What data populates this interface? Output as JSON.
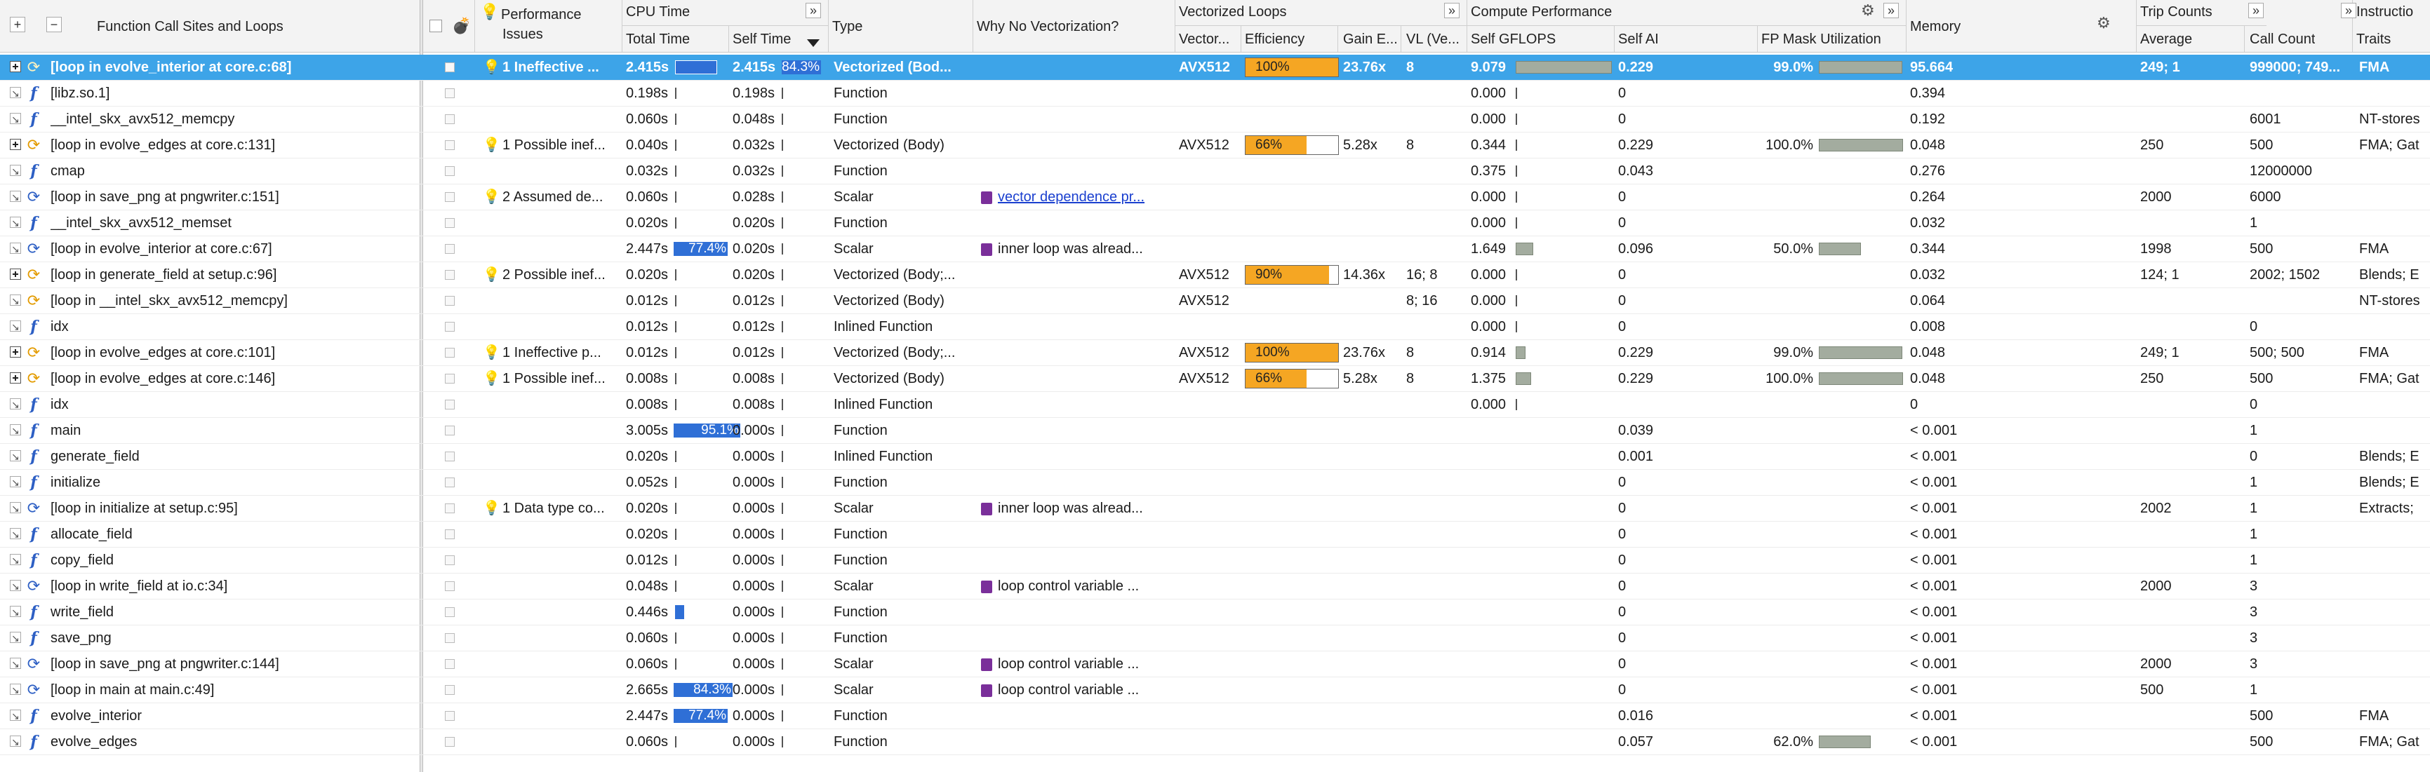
{
  "header": {
    "expand_all": "+",
    "collapse_all": "−",
    "function_col": "Function Call Sites and Loops",
    "perf_issues": [
      "Performance",
      "Issues"
    ],
    "cpu_time": "CPU Time",
    "total_time": "Total Time",
    "self_time": "Self Time",
    "type": "Type",
    "why_no_vec": "Why No Vectorization?",
    "vectorized_loops": "Vectorized Loops",
    "vector_isa": "Vector...",
    "efficiency": "Efficiency",
    "gain": "Gain E...",
    "vl": "VL (Ve...",
    "compute_perf": "Compute Performance",
    "self_gflops": "Self GFLOPS",
    "self_ai": "Self AI",
    "fp_mask": "FP Mask Utilization",
    "memory": "Memory",
    "trip_counts": "Trip Counts",
    "average": "Average",
    "call_count": "Call Count",
    "instructions": "Instructio",
    "traits": "Traits"
  },
  "rows": [
    {
      "kind": "loop-vec",
      "expand": "plus",
      "name": "[loop in evolve_interior at core.c:68]",
      "issue": "1 Ineffective ...",
      "bulb": "on",
      "total": "2.415s",
      "total_bar": 0,
      "self": "2.415s",
      "self_bar": 0.843,
      "self_label": "84.3%",
      "type": "Vectorized (Bod...",
      "why": "",
      "isa": "AVX512",
      "eff": 1.0,
      "eff_label": "100%",
      "gain": "23.76x",
      "vl": "8",
      "gflops": "9.079",
      "gflops_bar": 0.7,
      "ai": "0.229",
      "fpmask": "99.0%",
      "fpmask_bar": 0.99,
      "mem": "95.664",
      "avg": "249; 1",
      "calls": "999000; 749...",
      "traits": "FMA",
      "selected": true
    },
    {
      "kind": "fn",
      "expand": "arrow",
      "name": "[libz.so.1]",
      "issue": "",
      "total": "0.198s",
      "total_thin": true,
      "self": "0.198s",
      "self_thin": true,
      "type": "Function",
      "why": "",
      "isa": "",
      "eff_label": "",
      "gain": "",
      "vl": "",
      "gflops": "0.000",
      "gflops_thin": true,
      "ai": "0",
      "fpmask": "",
      "mem": "0.394",
      "avg": "",
      "calls": "",
      "traits": ""
    },
    {
      "kind": "fn",
      "expand": "arrow",
      "name": "__intel_skx_avx512_memcpy",
      "issue": "",
      "total": "0.060s",
      "total_thin": true,
      "self": "0.048s",
      "self_thin": true,
      "type": "Function",
      "why": "",
      "isa": "",
      "eff_label": "",
      "gain": "",
      "vl": "",
      "gflops": "0.000",
      "gflops_thin": true,
      "ai": "0",
      "fpmask": "",
      "mem": "0.192",
      "avg": "",
      "calls": "6001",
      "traits": "NT-stores"
    },
    {
      "kind": "loop-vec",
      "expand": "plus",
      "name": "[loop in evolve_edges at core.c:131]",
      "issue": "1 Possible inef...",
      "bulb": "on",
      "total": "0.040s",
      "total_thin": true,
      "self": "0.032s",
      "self_thin": true,
      "type": "Vectorized (Body)",
      "why": "",
      "isa": "AVX512",
      "eff": 0.66,
      "eff_label": "66%",
      "gain": "5.28x",
      "vl": "8",
      "gflops": "0.344",
      "gflops_thin": true,
      "ai": "0.229",
      "fpmask": "100.0%",
      "fpmask_bar": 1.0,
      "mem": "0.048",
      "avg": "250",
      "calls": "500",
      "traits": "FMA; Gat"
    },
    {
      "kind": "fn",
      "expand": "arrow",
      "name": "cmap",
      "issue": "",
      "total": "0.032s",
      "total_thin": true,
      "self": "0.032s",
      "self_thin": true,
      "type": "Function",
      "why": "",
      "isa": "",
      "eff_label": "",
      "gain": "",
      "vl": "",
      "gflops": "0.375",
      "gflops_thin": true,
      "ai": "0.043",
      "fpmask": "",
      "mem": "0.276",
      "avg": "",
      "calls": "12000000",
      "traits": ""
    },
    {
      "kind": "loop",
      "expand": "arrow",
      "name": "[loop in save_png at pngwriter.c:151]",
      "issue": "2 Assumed de...",
      "bulb": "on",
      "total": "0.060s",
      "total_thin": true,
      "self": "0.028s",
      "self_thin": true,
      "type": "Scalar",
      "why": "vector dependence pr...",
      "why_link": true,
      "isa": "",
      "eff_label": "",
      "gain": "",
      "vl": "",
      "gflops": "0.000",
      "gflops_thin": true,
      "ai": "0",
      "fpmask": "",
      "mem": "0.264",
      "avg": "2000",
      "calls": "6000",
      "traits": ""
    },
    {
      "kind": "fn",
      "expand": "arrow",
      "name": "__intel_skx_avx512_memset",
      "issue": "",
      "total": "0.020s",
      "total_thin": true,
      "self": "0.020s",
      "self_thin": true,
      "type": "Function",
      "why": "",
      "isa": "",
      "eff_label": "",
      "gain": "",
      "vl": "",
      "gflops": "0.000",
      "gflops_thin": true,
      "ai": "0",
      "fpmask": "",
      "mem": "0.032",
      "avg": "",
      "calls": "1",
      "traits": ""
    },
    {
      "kind": "loop",
      "expand": "arrow",
      "name": "[loop in evolve_interior at core.c:67]",
      "issue": "",
      "total": "2.447s",
      "total_bar": 0.774,
      "total_label": "77.4%",
      "self": "0.020s",
      "self_thin": true,
      "type": "Scalar",
      "why": "inner loop was alread...",
      "isa": "",
      "eff_label": "",
      "gain": "",
      "vl": "",
      "gflops": "1.649",
      "gflops_small": 0.13,
      "ai": "0.096",
      "fpmask": "50.0%",
      "fpmask_bar": 0.5,
      "mem": "0.344",
      "avg": "1998",
      "calls": "500",
      "traits": "FMA"
    },
    {
      "kind": "loop-vec",
      "expand": "plus",
      "name": "[loop in generate_field at setup.c:96]",
      "issue": "2 Possible inef...",
      "bulb": "on",
      "total": "0.020s",
      "total_thin": true,
      "self": "0.020s",
      "self_thin": true,
      "type": "Vectorized (Body;...",
      "why": "",
      "isa": "AVX512",
      "eff": 0.9,
      "eff_label": "90%",
      "gain": "14.36x",
      "vl": "16; 8",
      "gflops": "0.000",
      "gflops_thin": true,
      "ai": "0",
      "fpmask": "",
      "mem": "0.032",
      "avg": "124; 1",
      "calls": "2002; 1502",
      "traits": "Blends; E"
    },
    {
      "kind": "loop-vec",
      "expand": "arrow",
      "name": "[loop in __intel_skx_avx512_memcpy]",
      "issue": "",
      "total": "0.012s",
      "total_thin": true,
      "self": "0.012s",
      "self_thin": true,
      "type": "Vectorized (Body)",
      "why": "",
      "isa": "AVX512",
      "eff_label": "",
      "gain": "",
      "vl": "8; 16",
      "gflops": "0.000",
      "gflops_thin": true,
      "ai": "0",
      "fpmask": "",
      "mem": "0.064",
      "avg": "",
      "calls": "",
      "traits": "NT-stores"
    },
    {
      "kind": "fn",
      "expand": "arrow",
      "name": "idx",
      "issue": "",
      "total": "0.012s",
      "total_thin": true,
      "self": "0.012s",
      "self_thin": true,
      "type": "Inlined Function",
      "why": "",
      "isa": "",
      "eff_label": "",
      "gain": "",
      "vl": "",
      "gflops": "0.000",
      "gflops_thin": true,
      "ai": "0",
      "fpmask": "",
      "mem": "0.008",
      "avg": "",
      "calls": "0",
      "traits": ""
    },
    {
      "kind": "loop-vec",
      "expand": "plus",
      "name": "[loop in evolve_edges at core.c:101]",
      "issue": "1 Ineffective p...",
      "bulb": "on",
      "total": "0.012s",
      "total_thin": true,
      "self": "0.012s",
      "self_thin": true,
      "type": "Vectorized (Body;...",
      "why": "",
      "isa": "AVX512",
      "eff": 1.0,
      "eff_label": "100%",
      "gain": "23.76x",
      "vl": "8",
      "gflops": "0.914",
      "gflops_small": 0.07,
      "ai": "0.229",
      "fpmask": "99.0%",
      "fpmask_bar": 0.99,
      "mem": "0.048",
      "avg": "249; 1",
      "calls": "500; 500",
      "traits": "FMA"
    },
    {
      "kind": "loop-vec",
      "expand": "plus",
      "name": "[loop in evolve_edges at core.c:146]",
      "issue": "1 Possible inef...",
      "bulb": "on",
      "total": "0.008s",
      "total_thin": true,
      "self": "0.008s",
      "self_thin": true,
      "type": "Vectorized (Body)",
      "why": "",
      "isa": "AVX512",
      "eff": 0.66,
      "eff_label": "66%",
      "gain": "5.28x",
      "vl": "8",
      "gflops": "1.375",
      "gflops_small": 0.11,
      "ai": "0.229",
      "fpmask": "100.0%",
      "fpmask_bar": 1.0,
      "mem": "0.048",
      "avg": "250",
      "calls": "500",
      "traits": "FMA; Gat"
    },
    {
      "kind": "fn",
      "expand": "arrow",
      "name": "idx",
      "issue": "",
      "total": "0.008s",
      "total_thin": true,
      "self": "0.008s",
      "self_thin": true,
      "type": "Inlined Function",
      "why": "",
      "isa": "",
      "eff_label": "",
      "gain": "",
      "vl": "",
      "gflops": "0.000",
      "gflops_thin": true,
      "ai": "",
      "fpmask": "",
      "mem": "0",
      "avg": "",
      "calls": "0",
      "traits": ""
    },
    {
      "kind": "fn",
      "expand": "arrow",
      "name": "main",
      "issue": "",
      "total": "3.005s",
      "total_bar": 0.951,
      "total_label": "95.1%",
      "self": "0.000s",
      "self_thin": true,
      "type": "Function",
      "why": "",
      "isa": "",
      "eff_label": "",
      "gain": "",
      "vl": "",
      "gflops": "",
      "ai": "0.039",
      "fpmask": "",
      "mem": "< 0.001",
      "avg": "",
      "calls": "1",
      "traits": ""
    },
    {
      "kind": "fn",
      "expand": "arrow",
      "name": "generate_field",
      "issue": "",
      "total": "0.020s",
      "total_thin": true,
      "self": "0.000s",
      "self_thin": true,
      "type": "Inlined Function",
      "why": "",
      "isa": "",
      "eff_label": "",
      "gain": "",
      "vl": "",
      "gflops": "",
      "ai": "0.001",
      "fpmask": "",
      "mem": "< 0.001",
      "avg": "",
      "calls": "0",
      "traits": "Blends; E"
    },
    {
      "kind": "fn",
      "expand": "arrow",
      "name": "initialize",
      "issue": "",
      "total": "0.052s",
      "total_thin": true,
      "self": "0.000s",
      "self_thin": true,
      "type": "Function",
      "why": "",
      "isa": "",
      "eff_label": "",
      "gain": "",
      "vl": "",
      "gflops": "",
      "ai": "0",
      "fpmask": "",
      "mem": "< 0.001",
      "avg": "",
      "calls": "1",
      "traits": "Blends; E"
    },
    {
      "kind": "loop",
      "expand": "arrow",
      "name": "[loop in initialize at setup.c:95]",
      "issue": "1 Data type co...",
      "bulb": "off",
      "total": "0.020s",
      "total_thin": true,
      "self": "0.000s",
      "self_thin": true,
      "type": "Scalar",
      "why": "inner loop was alread...",
      "isa": "",
      "eff_label": "",
      "gain": "",
      "vl": "",
      "gflops": "",
      "ai": "0",
      "fpmask": "",
      "mem": "< 0.001",
      "avg": "2002",
      "calls": "1",
      "traits": "Extracts;"
    },
    {
      "kind": "fn",
      "expand": "arrow",
      "name": "allocate_field",
      "issue": "",
      "total": "0.020s",
      "total_thin": true,
      "self": "0.000s",
      "self_thin": true,
      "type": "Function",
      "why": "",
      "isa": "",
      "eff_label": "",
      "gain": "",
      "vl": "",
      "gflops": "",
      "ai": "0",
      "fpmask": "",
      "mem": "< 0.001",
      "avg": "",
      "calls": "1",
      "traits": ""
    },
    {
      "kind": "fn",
      "expand": "arrow",
      "name": "copy_field",
      "issue": "",
      "total": "0.012s",
      "total_thin": true,
      "self": "0.000s",
      "self_thin": true,
      "type": "Function",
      "why": "",
      "isa": "",
      "eff_label": "",
      "gain": "",
      "vl": "",
      "gflops": "",
      "ai": "0",
      "fpmask": "",
      "mem": "< 0.001",
      "avg": "",
      "calls": "1",
      "traits": ""
    },
    {
      "kind": "loop",
      "expand": "arrow",
      "name": "[loop in write_field at io.c:34]",
      "issue": "",
      "total": "0.048s",
      "total_thin": true,
      "self": "0.000s",
      "self_thin": true,
      "type": "Scalar",
      "why": "loop control variable ...",
      "isa": "",
      "eff_label": "",
      "gain": "",
      "vl": "",
      "gflops": "",
      "ai": "0",
      "fpmask": "",
      "mem": "< 0.001",
      "avg": "2000",
      "calls": "3",
      "traits": ""
    },
    {
      "kind": "fn",
      "expand": "arrow",
      "name": "write_field",
      "issue": "",
      "total": "0.446s",
      "total_small": 0.13,
      "self": "0.000s",
      "self_thin": true,
      "type": "Function",
      "why": "",
      "isa": "",
      "eff_label": "",
      "gain": "",
      "vl": "",
      "gflops": "",
      "ai": "0",
      "fpmask": "",
      "mem": "< 0.001",
      "avg": "",
      "calls": "3",
      "traits": ""
    },
    {
      "kind": "fn",
      "expand": "arrow",
      "name": "save_png",
      "issue": "",
      "total": "0.060s",
      "total_thin": true,
      "self": "0.000s",
      "self_thin": true,
      "type": "Function",
      "why": "",
      "isa": "",
      "eff_label": "",
      "gain": "",
      "vl": "",
      "gflops": "",
      "ai": "0",
      "fpmask": "",
      "mem": "< 0.001",
      "avg": "",
      "calls": "3",
      "traits": ""
    },
    {
      "kind": "loop",
      "expand": "arrow",
      "name": "[loop in save_png at pngwriter.c:144]",
      "issue": "",
      "total": "0.060s",
      "total_thin": true,
      "self": "0.000s",
      "self_thin": true,
      "type": "Scalar",
      "why": "loop control variable ...",
      "isa": "",
      "eff_label": "",
      "gain": "",
      "vl": "",
      "gflops": "",
      "ai": "0",
      "fpmask": "",
      "mem": "< 0.001",
      "avg": "2000",
      "calls": "3",
      "traits": ""
    },
    {
      "kind": "loop",
      "expand": "arrow",
      "name": "[loop in main at main.c:49]",
      "issue": "",
      "total": "2.665s",
      "total_bar": 0.843,
      "total_label": "84.3%",
      "self": "0.000s",
      "self_thin": true,
      "type": "Scalar",
      "why": "loop control variable ...",
      "isa": "",
      "eff_label": "",
      "gain": "",
      "vl": "",
      "gflops": "",
      "ai": "0",
      "fpmask": "",
      "mem": "< 0.001",
      "avg": "500",
      "calls": "1",
      "traits": ""
    },
    {
      "kind": "fn",
      "expand": "arrow",
      "name": "evolve_interior",
      "issue": "",
      "total": "2.447s",
      "total_bar": 0.774,
      "total_label": "77.4%",
      "self": "0.000s",
      "self_thin": true,
      "type": "Function",
      "why": "",
      "isa": "",
      "eff_label": "",
      "gain": "",
      "vl": "",
      "gflops": "",
      "ai": "0.016",
      "fpmask": "",
      "mem": "< 0.001",
      "avg": "",
      "calls": "500",
      "traits": "FMA"
    },
    {
      "kind": "fn",
      "expand": "arrow",
      "name": "evolve_edges",
      "issue": "",
      "total": "0.060s",
      "total_thin": true,
      "self": "0.000s",
      "self_thin": true,
      "type": "Function",
      "why": "",
      "isa": "",
      "eff_label": "",
      "gain": "",
      "vl": "",
      "gflops": "",
      "ai": "0.057",
      "fpmask": "62.0%",
      "fpmask_bar": 0.62,
      "mem": "< 0.001",
      "avg": "",
      "calls": "500",
      "traits": "FMA; Gat"
    }
  ],
  "colors": {
    "selected_row": "#3da4e8",
    "cpu_bar": "#2f6fd6",
    "efficiency": "#f5a623",
    "gflops_bar": "#a3ac9f"
  }
}
